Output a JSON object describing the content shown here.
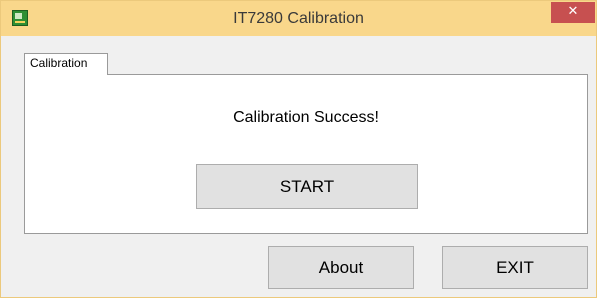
{
  "window": {
    "title": "IT7280 Calibration",
    "close_label": "✕",
    "titlebar_color": "#f9d78b",
    "close_color": "#c75050"
  },
  "tabs": [
    {
      "label": "Calibration",
      "active": true
    }
  ],
  "panel": {
    "status_text": "Calibration Success!",
    "start_label": "START"
  },
  "footer": {
    "about_label": "About",
    "exit_label": "EXIT"
  },
  "icons": {
    "app": "app-icon",
    "close": "close-icon"
  }
}
